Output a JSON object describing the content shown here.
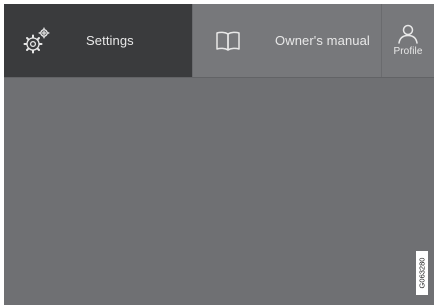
{
  "topbar": {
    "settings": {
      "label": "Settings",
      "icon": "gear-icon"
    },
    "manual": {
      "label": "Owner's manual",
      "icon": "book-icon"
    },
    "profile": {
      "label": "Profile",
      "icon": "person-icon"
    }
  },
  "figure_ref": "G063280",
  "colors": {
    "active_tab": "#3a3b3d",
    "inactive_tab": "#77787b",
    "background": "#6f7073",
    "text": "#e8e8e8"
  }
}
